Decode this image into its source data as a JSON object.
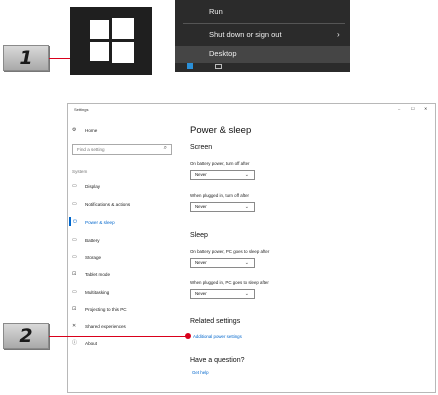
{
  "steps": {
    "one": "1",
    "two": "2"
  },
  "context_menu": {
    "run": "Run",
    "shutdown": "Shut down or sign out",
    "desktop": "Desktop"
  },
  "window": {
    "title": "Settings",
    "minimize": "–",
    "maximize": "☐",
    "close": "✕"
  },
  "sidebar": {
    "home": "Home",
    "search_placeholder": "Find a setting",
    "section": "System",
    "items": [
      "Display",
      "Notifications & actions",
      "Power & sleep",
      "Battery",
      "Storage",
      "Tablet mode",
      "Multitasking",
      "Projecting to this PC",
      "Shared experiences",
      "About"
    ]
  },
  "main": {
    "title": "Power & sleep",
    "screen": {
      "heading": "Screen",
      "battery_label": "On battery power, turn off after",
      "battery_value": "Never",
      "plugged_label": "When plugged in, turn off after",
      "plugged_value": "Never"
    },
    "sleep": {
      "heading": "Sleep",
      "battery_label": "On battery power, PC goes to sleep after",
      "battery_value": "Never",
      "plugged_label": "When plugged in, PC goes to sleep after",
      "plugged_value": "Never"
    },
    "related": {
      "heading": "Related settings",
      "link": "Additional power settings"
    },
    "question": {
      "heading": "Have a question?",
      "link": "Get help"
    }
  },
  "colors": {
    "accent": "#0066cc",
    "leader": "#d9001b"
  }
}
